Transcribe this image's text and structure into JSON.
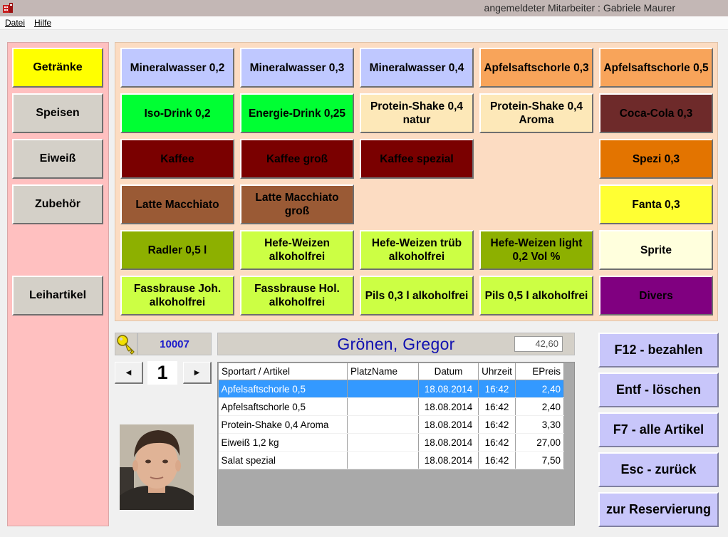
{
  "title": {
    "text": "angemeldeter Mitarbeiter :  Gabriele Maurer"
  },
  "menu": [
    {
      "label": "Datei",
      "name": "menu-datei"
    },
    {
      "label": "Hilfe",
      "name": "menu-hilfe"
    }
  ],
  "categories": [
    {
      "label": "Getränke",
      "color": "#ffff00",
      "name": "category-getraenke"
    },
    {
      "label": "Speisen",
      "color": "#d4d0c8",
      "name": "category-speisen"
    },
    {
      "label": "Eiweiß",
      "color": "#d4d0c8",
      "name": "category-eiweiss"
    },
    {
      "label": "Zubehör",
      "color": "#d4d0c8",
      "name": "category-zubehoer"
    },
    {
      "label": "Leihartikel",
      "color": "#d4d0c8",
      "name": "category-leihartikel"
    }
  ],
  "products": [
    [
      {
        "label": "Mineralwasser 0,2",
        "bg": "#bfc8ff",
        "fg": "#000000"
      },
      {
        "label": "Mineralwasser 0,3",
        "bg": "#bfc8ff",
        "fg": "#000000"
      },
      {
        "label": "Mineralwasser 0,4",
        "bg": "#bfc8ff",
        "fg": "#000000"
      },
      {
        "label": "Apfelsaftschorle 0,3",
        "bg": "#f8a45a",
        "fg": "#000000"
      },
      {
        "label": "Apfelsaftschorle 0,5",
        "bg": "#f8a45a",
        "fg": "#000000"
      }
    ],
    [
      {
        "label": "Iso-Drink 0,2",
        "bg": "#00ff33",
        "fg": "#000000"
      },
      {
        "label": "Energie-Drink 0,25",
        "bg": "#00ff33",
        "fg": "#000000"
      },
      {
        "label": "Protein-Shake 0,4 natur",
        "bg": "#fde8b8",
        "fg": "#000000"
      },
      {
        "label": "Protein-Shake 0,4 Aroma",
        "bg": "#fde8b8",
        "fg": "#000000"
      },
      {
        "label": "Coca-Cola 0,3",
        "bg": "#6e2a2a",
        "fg": "#000000"
      }
    ],
    [
      {
        "label": "Kaffee",
        "bg": "#7a0000",
        "fg": "#000000"
      },
      {
        "label": "Kaffee groß",
        "bg": "#7a0000",
        "fg": "#000000"
      },
      {
        "label": "Kaffee spezial",
        "bg": "#7a0000",
        "fg": "#000000"
      },
      null,
      {
        "label": "Spezi 0,3",
        "bg": "#e37400",
        "fg": "#000000"
      }
    ],
    [
      {
        "label": "Latte Macchiato",
        "bg": "#9a5a35",
        "fg": "#000000"
      },
      {
        "label": "Latte Macchiato groß",
        "bg": "#9a5a35",
        "fg": "#000000"
      },
      null,
      null,
      {
        "label": "Fanta 0,3",
        "bg": "#ffff33",
        "fg": "#000000"
      }
    ],
    [
      {
        "label": "Radler 0,5 l",
        "bg": "#8db000",
        "fg": "#000000"
      },
      {
        "label": "Hefe-Weizen alkoholfrei",
        "bg": "#ccff44",
        "fg": "#000000"
      },
      {
        "label": "Hefe-Weizen trüb alkoholfrei",
        "bg": "#ccff44",
        "fg": "#000000"
      },
      {
        "label": "Hefe-Weizen light 0,2 Vol %",
        "bg": "#8db000",
        "fg": "#000000"
      },
      {
        "label": "Sprite",
        "bg": "#ffffdd",
        "fg": "#000000"
      }
    ],
    [
      {
        "label": "Fassbrause Joh. alkoholfrei",
        "bg": "#ccff44",
        "fg": "#000000"
      },
      {
        "label": "Fassbrause Hol. alkoholfrei",
        "bg": "#ccff44",
        "fg": "#000000"
      },
      {
        "label": "Pils 0,3 l alkoholfrei",
        "bg": "#ccff44",
        "fg": "#000000"
      },
      {
        "label": "Pils 0,5 l alkoholfrei",
        "bg": "#ccff44",
        "fg": "#000000"
      },
      {
        "label": "Divers",
        "bg": "#800080",
        "fg": "#000000"
      }
    ]
  ],
  "customer": {
    "id": "10007",
    "name": "Grönen, Gregor",
    "balance": "42,60",
    "page": "1"
  },
  "nav": {
    "prev_icon": "triangle-left-icon",
    "next_icon": "triangle-right-icon"
  },
  "table": {
    "columns": [
      "Sportart / Artikel",
      "PlatzName",
      "Datum",
      "Uhrzeit",
      "EPreis"
    ],
    "rows": [
      {
        "artikel": "Apfelsaftschorle 0,5",
        "platz": "",
        "datum": "18.08.2014",
        "uhrzeit": "16:42",
        "preis": "2,40",
        "selected": true
      },
      {
        "artikel": "Apfelsaftschorle 0,5",
        "platz": "",
        "datum": "18.08.2014",
        "uhrzeit": "16:42",
        "preis": "2,40",
        "selected": false
      },
      {
        "artikel": "Protein-Shake 0,4 Aroma",
        "platz": "",
        "datum": "18.08.2014",
        "uhrzeit": "16:42",
        "preis": "3,30",
        "selected": false
      },
      {
        "artikel": "Eiweiß 1,2 kg",
        "platz": "",
        "datum": "18.08.2014",
        "uhrzeit": "16:42",
        "preis": "27,00",
        "selected": false
      },
      {
        "artikel": "Salat spezial",
        "platz": "",
        "datum": "18.08.2014",
        "uhrzeit": "16:42",
        "preis": "7,50",
        "selected": false
      }
    ]
  },
  "actions": [
    {
      "label": "F12 - bezahlen",
      "name": "pay-button"
    },
    {
      "label": "Entf - löschen",
      "name": "delete-button"
    },
    {
      "label": "F7 - alle Artikel",
      "name": "all-articles-button"
    },
    {
      "label": "Esc - zurück",
      "name": "back-button"
    },
    {
      "label": "zur Reservierung",
      "name": "reservation-button"
    }
  ],
  "icons": {
    "app": "building-icon",
    "key": "key-icon",
    "photo": "customer-photo"
  }
}
